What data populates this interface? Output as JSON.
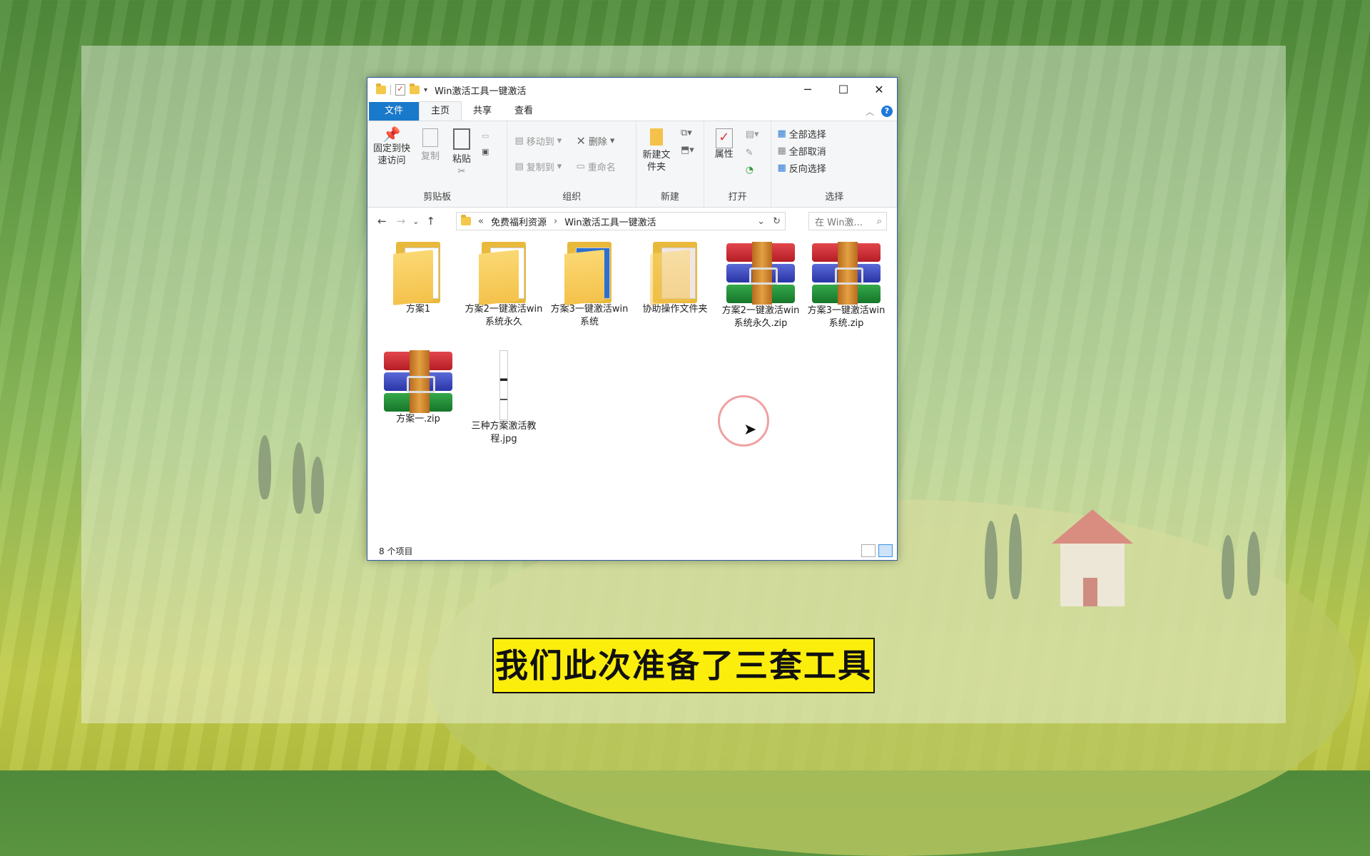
{
  "window": {
    "title": "Win激活工具一键激活",
    "minimize_glyph": "─",
    "maximize_glyph": "☐",
    "close_glyph": "✕"
  },
  "tabs": [
    {
      "label": "文件"
    },
    {
      "label": "主页"
    },
    {
      "label": "共享"
    },
    {
      "label": "查看"
    }
  ],
  "ribbon": {
    "clipboard": {
      "pin_label": "固定到快速访问",
      "copy_label": "复制",
      "paste_label": "粘贴",
      "group_label": "剪贴板"
    },
    "organize": {
      "move_label": "移动到",
      "copy_to_label": "复制到",
      "delete_label": "删除",
      "rename_label": "重命名",
      "group_label": "组织"
    },
    "new": {
      "new_folder_label": "新建文件夹",
      "group_label": "新建"
    },
    "open": {
      "properties_label": "属性",
      "group_label": "打开"
    },
    "select": {
      "select_all_label": "全部选择",
      "select_none_label": "全部取消",
      "invert_label": "反向选择",
      "group_label": "选择"
    }
  },
  "address": {
    "prefix": "«",
    "crumb1": "免费福利资源",
    "separator": "›",
    "crumb2": "Win激活工具一键激活",
    "search_placeholder": "在 Win激..."
  },
  "files": [
    {
      "name": "方案1",
      "icon": "folder-icon"
    },
    {
      "name": "方案2一键激活win系统永久",
      "icon": "folder-icon"
    },
    {
      "name": "方案3一键激活win系统",
      "icon": "folder-icon"
    },
    {
      "name": "协助操作文件夹",
      "icon": "folder-icon"
    },
    {
      "name": "方案2一键激活win系统永久.zip",
      "icon": "winrar-archive-icon"
    },
    {
      "name": "方案3一键激活win系统.zip",
      "icon": "winrar-archive-icon"
    },
    {
      "name": "方案一.zip",
      "icon": "winrar-archive-icon"
    },
    {
      "name": "三种方案激活教程.jpg",
      "icon": "image-file-icon"
    }
  ],
  "status": {
    "count": "8 个项目"
  },
  "subtitle": "我们此次准备了三套工具",
  "colors": {
    "file_tab": "#1979ca",
    "subtitle_bg": "#fcee0c",
    "cursor_ring": "#f0a1a1"
  }
}
